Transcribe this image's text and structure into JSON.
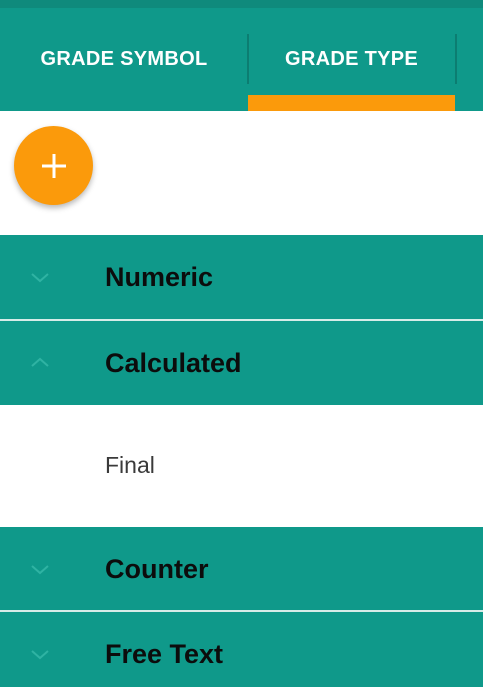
{
  "colors": {
    "primary": "#0f998a",
    "primary_dark": "#0f8a7c",
    "accent": "#fb9a0b"
  },
  "tabs": [
    {
      "label": "GRADE SYMBOL",
      "selected": false
    },
    {
      "label": "GRADE TYPE",
      "selected": true
    }
  ],
  "fab": {
    "icon": "plus-icon"
  },
  "groups": [
    {
      "label": "Numeric",
      "expanded": false,
      "icon": "chevron-down-icon"
    },
    {
      "label": "Calculated",
      "expanded": true,
      "icon": "chevron-up-icon",
      "items": [
        "Final"
      ]
    },
    {
      "label": "Counter",
      "expanded": false,
      "icon": "chevron-down-icon"
    },
    {
      "label": "Free Text",
      "expanded": false,
      "icon": "chevron-down-icon"
    }
  ]
}
